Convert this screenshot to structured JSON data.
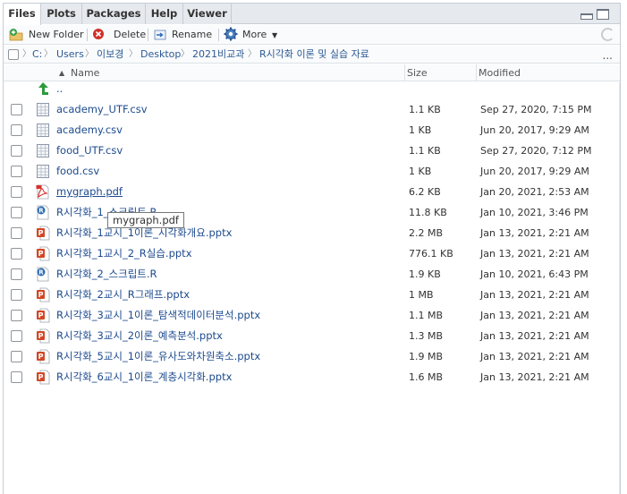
{
  "tabs": [
    "Files",
    "Plots",
    "Packages",
    "Help",
    "Viewer"
  ],
  "toolbar": {
    "new_folder": "New Folder",
    "delete": "Delete",
    "rename": "Rename",
    "more": "More"
  },
  "breadcrumb": [
    "C:",
    "Users",
    "이보경",
    "Desktop",
    "2021비교과",
    "R시각화 이론 및 실습 자료"
  ],
  "breadcrumb_more": "...",
  "columns": {
    "name": "Name",
    "size": "Size",
    "modified": "Modified"
  },
  "parent_dir": "..",
  "files": [
    {
      "name": "academy_UTF.csv",
      "size": "1.1 KB",
      "modified": "Sep 27, 2020, 7:15 PM",
      "icon": "csv-icon"
    },
    {
      "name": "academy.csv",
      "size": "1 KB",
      "modified": "Jun 20, 2017, 9:29 AM",
      "icon": "csv-icon"
    },
    {
      "name": "food_UTF.csv",
      "size": "1.1 KB",
      "modified": "Sep 27, 2020, 7:12 PM",
      "icon": "csv-icon"
    },
    {
      "name": "food.csv",
      "size": "1 KB",
      "modified": "Jun 20, 2017, 9:29 AM",
      "icon": "csv-icon"
    },
    {
      "name": "mygraph.pdf",
      "size": "6.2 KB",
      "modified": "Jan 20, 2021, 2:53 AM",
      "icon": "pdf-icon"
    },
    {
      "name": "R시각화_1_스크립트.R",
      "size": "11.8 KB",
      "modified": "Jan 10, 2021, 3:46 PM",
      "icon": "r-script-icon"
    },
    {
      "name": "R시각화_1교시_1이론_시각화개요.pptx",
      "size": "2.2 MB",
      "modified": "Jan 13, 2021, 2:21 AM",
      "icon": "pptx-icon"
    },
    {
      "name": "R시각화_1교시_2_R실습.pptx",
      "size": "776.1 KB",
      "modified": "Jan 13, 2021, 2:21 AM",
      "icon": "pptx-icon"
    },
    {
      "name": "R시각화_2_스크립트.R",
      "size": "1.9 KB",
      "modified": "Jan 10, 2021, 6:43 PM",
      "icon": "r-script-icon"
    },
    {
      "name": "R시각화_2교시_R그래프.pptx",
      "size": "1 MB",
      "modified": "Jan 13, 2021, 2:21 AM",
      "icon": "pptx-icon"
    },
    {
      "name": "R시각화_3교시_1이론_탐색적데이터분석.pptx",
      "size": "1.1 MB",
      "modified": "Jan 13, 2021, 2:21 AM",
      "icon": "pptx-icon"
    },
    {
      "name": "R시각화_3교시_2이론_예측분석.pptx",
      "size": "1.3 MB",
      "modified": "Jan 13, 2021, 2:21 AM",
      "icon": "pptx-icon"
    },
    {
      "name": "R시각화_5교시_1이론_유사도와차원축소.pptx",
      "size": "1.9 MB",
      "modified": "Jan 13, 2021, 2:21 AM",
      "icon": "pptx-icon"
    },
    {
      "name": "R시각화_6교시_1이론_계층시각화.pptx",
      "size": "1.6 MB",
      "modified": "Jan 13, 2021, 2:21 AM",
      "icon": "pptx-icon"
    }
  ],
  "tooltip": "mygraph.pdf",
  "colors": {
    "link": "#1c4a8e",
    "pdf": "#d9302c",
    "pptx": "#d24726",
    "r_script": "#2f6db5",
    "folder_up": "#2e9a3a"
  }
}
